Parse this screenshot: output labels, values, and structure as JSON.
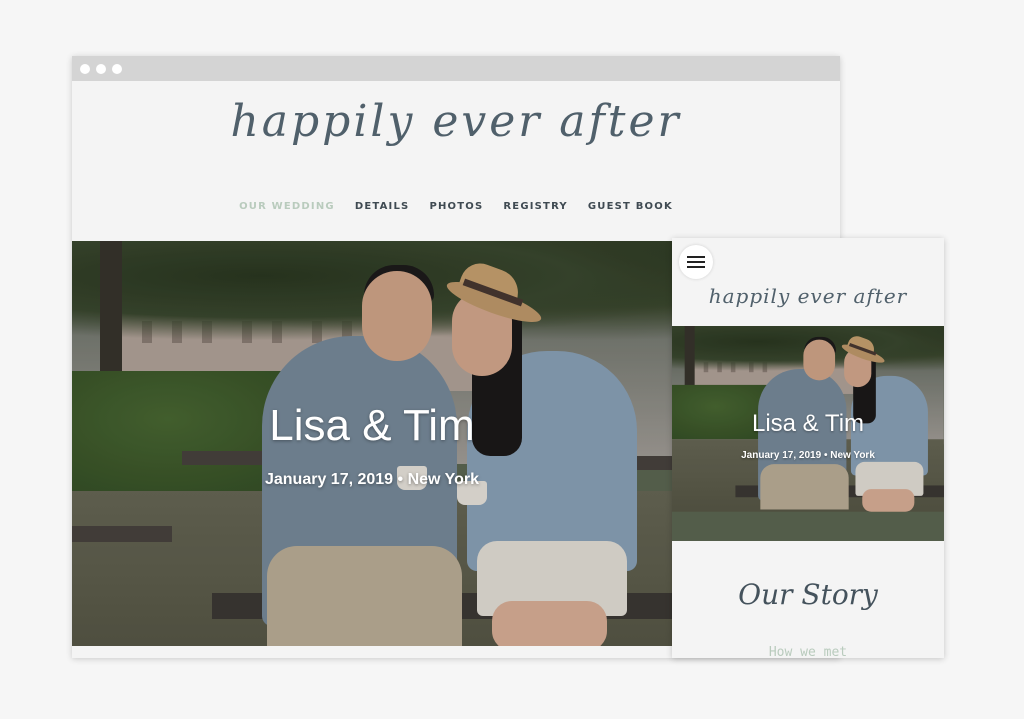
{
  "desktop": {
    "site_title": "happily ever after",
    "nav": [
      {
        "label": "OUR WEDDING",
        "active": true
      },
      {
        "label": "DETAILS",
        "active": false
      },
      {
        "label": "PHOTOS",
        "active": false
      },
      {
        "label": "REGISTRY",
        "active": false
      },
      {
        "label": "GUEST BOOK",
        "active": false
      }
    ],
    "hero": {
      "names": "Lisa & Tim",
      "date_location": "January 17, 2019 • New York"
    }
  },
  "mobile": {
    "menu_icon": "hamburger-menu-icon",
    "site_title": "happily ever after",
    "hero": {
      "names": "Lisa & Tim",
      "date_location": "January 17, 2019 • New York"
    },
    "section_title": "Our Story",
    "section_subtitle": "How we met"
  },
  "colors": {
    "page_background": "#f6f6f6",
    "title_text": "#50606b",
    "nav_text": "#3f4a52",
    "nav_active": "#b9cbbd",
    "browser_bar": "#d4d4d4"
  }
}
